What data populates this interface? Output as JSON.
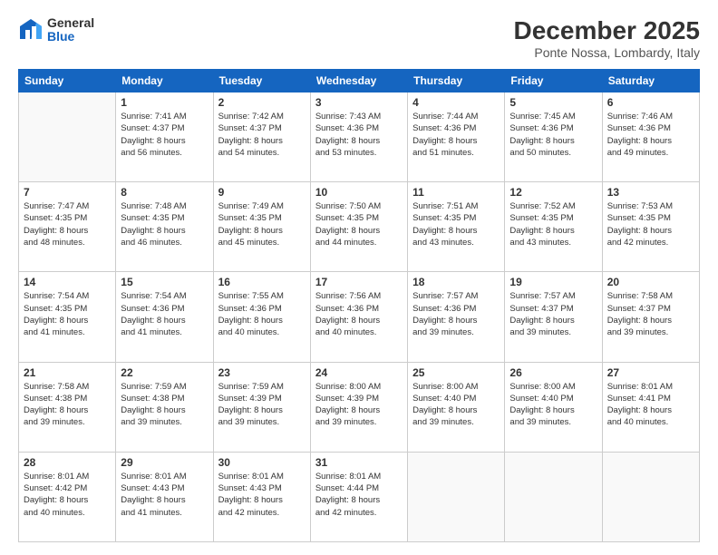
{
  "logo": {
    "general": "General",
    "blue": "Blue"
  },
  "header": {
    "title": "December 2025",
    "subtitle": "Ponte Nossa, Lombardy, Italy"
  },
  "weekdays": [
    "Sunday",
    "Monday",
    "Tuesday",
    "Wednesday",
    "Thursday",
    "Friday",
    "Saturday"
  ],
  "weeks": [
    [
      {
        "day": "",
        "info": ""
      },
      {
        "day": "1",
        "info": "Sunrise: 7:41 AM\nSunset: 4:37 PM\nDaylight: 8 hours\nand 56 minutes."
      },
      {
        "day": "2",
        "info": "Sunrise: 7:42 AM\nSunset: 4:37 PM\nDaylight: 8 hours\nand 54 minutes."
      },
      {
        "day": "3",
        "info": "Sunrise: 7:43 AM\nSunset: 4:36 PM\nDaylight: 8 hours\nand 53 minutes."
      },
      {
        "day": "4",
        "info": "Sunrise: 7:44 AM\nSunset: 4:36 PM\nDaylight: 8 hours\nand 51 minutes."
      },
      {
        "day": "5",
        "info": "Sunrise: 7:45 AM\nSunset: 4:36 PM\nDaylight: 8 hours\nand 50 minutes."
      },
      {
        "day": "6",
        "info": "Sunrise: 7:46 AM\nSunset: 4:36 PM\nDaylight: 8 hours\nand 49 minutes."
      }
    ],
    [
      {
        "day": "7",
        "info": "Sunrise: 7:47 AM\nSunset: 4:35 PM\nDaylight: 8 hours\nand 48 minutes."
      },
      {
        "day": "8",
        "info": "Sunrise: 7:48 AM\nSunset: 4:35 PM\nDaylight: 8 hours\nand 46 minutes."
      },
      {
        "day": "9",
        "info": "Sunrise: 7:49 AM\nSunset: 4:35 PM\nDaylight: 8 hours\nand 45 minutes."
      },
      {
        "day": "10",
        "info": "Sunrise: 7:50 AM\nSunset: 4:35 PM\nDaylight: 8 hours\nand 44 minutes."
      },
      {
        "day": "11",
        "info": "Sunrise: 7:51 AM\nSunset: 4:35 PM\nDaylight: 8 hours\nand 43 minutes."
      },
      {
        "day": "12",
        "info": "Sunrise: 7:52 AM\nSunset: 4:35 PM\nDaylight: 8 hours\nand 43 minutes."
      },
      {
        "day": "13",
        "info": "Sunrise: 7:53 AM\nSunset: 4:35 PM\nDaylight: 8 hours\nand 42 minutes."
      }
    ],
    [
      {
        "day": "14",
        "info": "Sunrise: 7:54 AM\nSunset: 4:35 PM\nDaylight: 8 hours\nand 41 minutes."
      },
      {
        "day": "15",
        "info": "Sunrise: 7:54 AM\nSunset: 4:36 PM\nDaylight: 8 hours\nand 41 minutes."
      },
      {
        "day": "16",
        "info": "Sunrise: 7:55 AM\nSunset: 4:36 PM\nDaylight: 8 hours\nand 40 minutes."
      },
      {
        "day": "17",
        "info": "Sunrise: 7:56 AM\nSunset: 4:36 PM\nDaylight: 8 hours\nand 40 minutes."
      },
      {
        "day": "18",
        "info": "Sunrise: 7:57 AM\nSunset: 4:36 PM\nDaylight: 8 hours\nand 39 minutes."
      },
      {
        "day": "19",
        "info": "Sunrise: 7:57 AM\nSunset: 4:37 PM\nDaylight: 8 hours\nand 39 minutes."
      },
      {
        "day": "20",
        "info": "Sunrise: 7:58 AM\nSunset: 4:37 PM\nDaylight: 8 hours\nand 39 minutes."
      }
    ],
    [
      {
        "day": "21",
        "info": "Sunrise: 7:58 AM\nSunset: 4:38 PM\nDaylight: 8 hours\nand 39 minutes."
      },
      {
        "day": "22",
        "info": "Sunrise: 7:59 AM\nSunset: 4:38 PM\nDaylight: 8 hours\nand 39 minutes."
      },
      {
        "day": "23",
        "info": "Sunrise: 7:59 AM\nSunset: 4:39 PM\nDaylight: 8 hours\nand 39 minutes."
      },
      {
        "day": "24",
        "info": "Sunrise: 8:00 AM\nSunset: 4:39 PM\nDaylight: 8 hours\nand 39 minutes."
      },
      {
        "day": "25",
        "info": "Sunrise: 8:00 AM\nSunset: 4:40 PM\nDaylight: 8 hours\nand 39 minutes."
      },
      {
        "day": "26",
        "info": "Sunrise: 8:00 AM\nSunset: 4:40 PM\nDaylight: 8 hours\nand 39 minutes."
      },
      {
        "day": "27",
        "info": "Sunrise: 8:01 AM\nSunset: 4:41 PM\nDaylight: 8 hours\nand 40 minutes."
      }
    ],
    [
      {
        "day": "28",
        "info": "Sunrise: 8:01 AM\nSunset: 4:42 PM\nDaylight: 8 hours\nand 40 minutes."
      },
      {
        "day": "29",
        "info": "Sunrise: 8:01 AM\nSunset: 4:43 PM\nDaylight: 8 hours\nand 41 minutes."
      },
      {
        "day": "30",
        "info": "Sunrise: 8:01 AM\nSunset: 4:43 PM\nDaylight: 8 hours\nand 42 minutes."
      },
      {
        "day": "31",
        "info": "Sunrise: 8:01 AM\nSunset: 4:44 PM\nDaylight: 8 hours\nand 42 minutes."
      },
      {
        "day": "",
        "info": ""
      },
      {
        "day": "",
        "info": ""
      },
      {
        "day": "",
        "info": ""
      }
    ]
  ]
}
